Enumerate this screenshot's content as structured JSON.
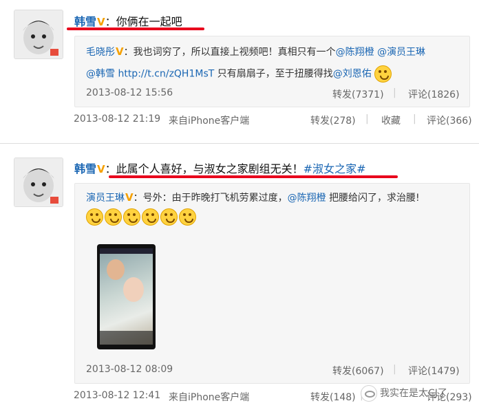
{
  "posts": [
    {
      "author": "韩雪",
      "v_badge": "V",
      "colon": "：",
      "text": "你俩在一起吧",
      "tag": "",
      "quote": {
        "line1_author": "毛晓彤",
        "line1_text": "：我也词穷了，所以直接上视频吧！真相只有一个",
        "line1_mention1": "@陈翔橙",
        "line1_mention2": "@演员王琳",
        "line2_mention": "@韩雪",
        "line2_link": "http://t.cn/zQH1MsT",
        "line2_text": "只有扇扇子，至于扭腰得找",
        "line2_mention2": "@刘恩佑",
        "time": "2013-08-12 15:56",
        "repost": "转发(7371)",
        "comment": "评论(1826)"
      },
      "time": "2013-08-12 21:19",
      "source": "来自iPhone客户端",
      "repost": "转发(278)",
      "fav": "收藏",
      "comment": "评论(366)"
    },
    {
      "author": "韩雪",
      "v_badge": "V",
      "colon": "：",
      "text": "此属个人喜好，与淑女之家剧组无关！",
      "tag": "#淑女之家#",
      "quote": {
        "line1_author": "演员王琳",
        "line1_text": "：号外：由于昨晚打飞机劳累过度，",
        "line1_mention1": "@陈翔橙",
        "line1_text2": "把腰给闪了，求治腰!",
        "time": "2013-08-12 08:09",
        "repost": "转发(6067)",
        "comment": "评论(1479)"
      },
      "time": "2013-08-12 12:41",
      "source": "来自iPhone客户端",
      "repost": "转发(148)",
      "comment": "评论(293)"
    }
  ],
  "watermark": "我实在是太CJ了",
  "colors": {
    "link": "#1a66b3",
    "underline": "#e8001c",
    "vbadge": "#f5a000"
  }
}
